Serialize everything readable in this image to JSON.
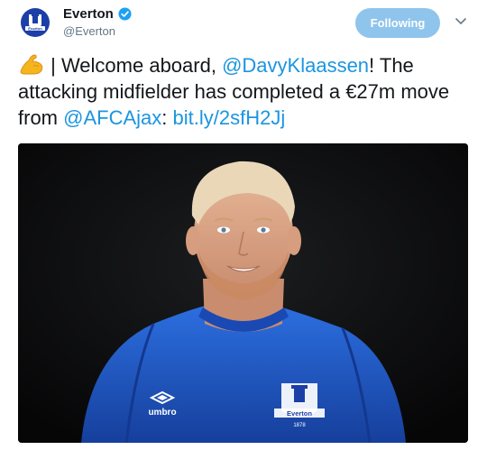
{
  "account": {
    "name": "Everton",
    "handle": "@Everton",
    "follow_label": "Following",
    "colors": {
      "brand": "#1b3fa6",
      "verified": "#1da1f2",
      "follow_bg": "#8fc4ec",
      "link": "#1b95e0"
    }
  },
  "tweet": {
    "emoji": "flexed-biceps-emoji",
    "part1": " | Welcome aboard, ",
    "mention1": "@DavyKlaassen",
    "part2": "! The attacking midfielder has completed a €27m move from ",
    "mention2": "@AFCAjax",
    "part3": ": ",
    "link": "bit.ly/2sfH2Jj"
  },
  "photo": {
    "kit_brand": "umbro",
    "crest_text": "Everton",
    "crest_year": "1878"
  }
}
